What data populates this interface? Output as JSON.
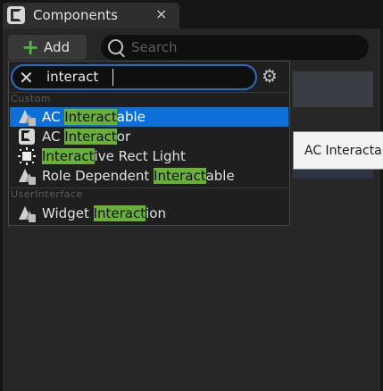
{
  "panel": {
    "title": "Components",
    "close_glyph": "×",
    "icon": "blueprint-c-icon"
  },
  "toolbar": {
    "add_label": "Add",
    "add_glyph": "+",
    "search_placeholder": "Search"
  },
  "popup": {
    "filter_value": "interact",
    "clear_glyph": "✕",
    "settings_glyph": "⚙",
    "categories": [
      {
        "label": "Custom",
        "items": [
          {
            "pre": "AC ",
            "match": "Interact",
            "post": "able",
            "icon": "actor-component-icon",
            "selected": true
          },
          {
            "pre": "AC ",
            "match": "Interact",
            "post": "or",
            "icon": "blueprint-class-icon",
            "selected": false
          },
          {
            "pre": "",
            "match": "Interact",
            "post": "ive Rect Light",
            "icon": "rect-light-icon",
            "selected": false
          },
          {
            "pre": "Role Dependent ",
            "match": "Interact",
            "post": "able",
            "icon": "actor-component-icon",
            "selected": false
          }
        ]
      },
      {
        "label": "UserInterface",
        "items": [
          {
            "pre": "Widget ",
            "match": "Interact",
            "post": "ion",
            "icon": "actor-component-icon",
            "selected": false
          }
        ]
      }
    ]
  },
  "tooltip": {
    "text": "AC Interactable"
  },
  "colors": {
    "selection": "#0e6fd6",
    "highlight": "#6aae3c",
    "focus_border": "#2c6cc4",
    "add_plus": "#57b34a"
  }
}
